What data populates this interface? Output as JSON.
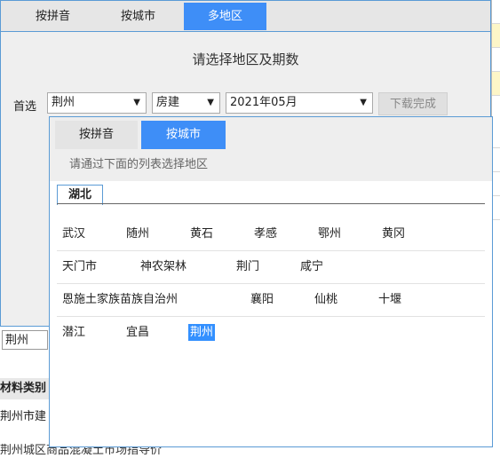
{
  "outer": {
    "tabs": [
      "按拼音",
      "按城市",
      "多地区"
    ],
    "active_tab": 2,
    "title": "请选择地区及期数",
    "label_primary": "首选",
    "select_city": "荆州",
    "select_category": "房建",
    "select_period": "2021年05月",
    "download_button": "下载完成"
  },
  "inner": {
    "tabs": [
      "按拼音",
      "按城市"
    ],
    "active_tab": 1,
    "hint": "请通过下面的列表选择地区",
    "province_tab": "湖北",
    "rows": [
      [
        "武汉",
        "随州",
        "黄石",
        "孝感",
        "鄂州",
        "黄冈"
      ],
      [
        "天门市",
        "神农架林",
        "荆门",
        "咸宁"
      ],
      [
        "恩施土家族苗族自治州",
        "襄阳",
        "仙桃",
        "十堰"
      ],
      [
        "潜江",
        "宜昌",
        "荆州"
      ]
    ],
    "selected_city": "荆州"
  },
  "background": {
    "bottom_input": "荆州",
    "row_category": "材料类别",
    "row_a": "荆州市建",
    "row_b": "荆州城区商品混凝土市场指导价"
  }
}
